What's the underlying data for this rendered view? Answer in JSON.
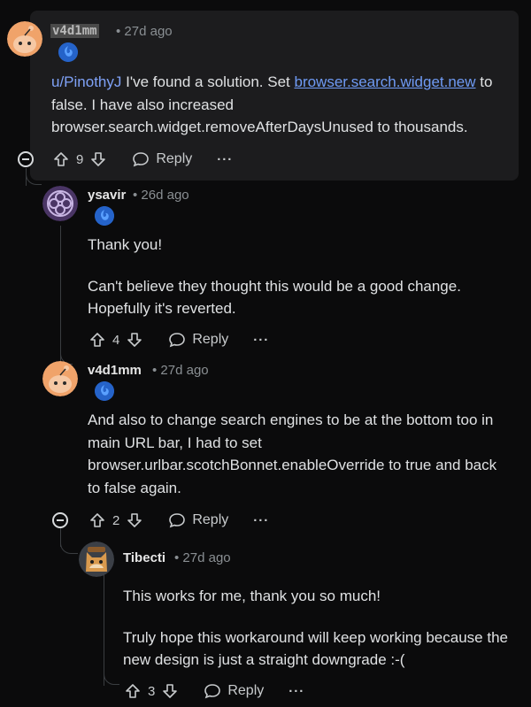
{
  "comments": [
    {
      "username": "v4d1mm",
      "time": "• 27d ago",
      "text_mention": "u/PinothyJ",
      "text_part1": " I've found a solution. Set ",
      "text_link": "browser.search.widget.new",
      "text_part2": " to false. I have also increased browser.search.widget.removeAfterDaysUnused to thousands.",
      "votes": "9",
      "reply_label": "Reply",
      "more_label": "···"
    },
    {
      "username": "ysavir",
      "time": "• 26d ago",
      "paragraphs": [
        "Thank you!",
        "Can't believe they thought this would be a good change. Hopefully it's reverted."
      ],
      "votes": "4",
      "reply_label": "Reply",
      "more_label": "···"
    },
    {
      "username": "v4d1mm",
      "time": "• 27d ago",
      "paragraphs": [
        "And also to change search engines to be at the bottom too in main URL bar, I had to set browser.urlbar.scotchBonnet.enableOverride to true and back to false again."
      ],
      "votes": "2",
      "reply_label": "Reply",
      "more_label": "···"
    },
    {
      "username": "Tibecti",
      "time": "• 27d ago",
      "paragraphs": [
        "This works for me, thank you so much!",
        "Truly hope this workaround will keep working because the new design is just a straight downgrade :-("
      ],
      "votes": "3",
      "reply_label": "Reply",
      "more_label": "···"
    }
  ],
  "colors": {
    "background": "#0b0b0c",
    "highlight": "#1c1c1e",
    "link": "#6f9bf5",
    "flair": "#2563c9",
    "snoo_orange": "#f0a36a"
  },
  "icons": [
    "snoo-avatar-icon",
    "firefox-flair-icon",
    "upvote-icon",
    "downvote-icon",
    "comment-icon",
    "collapse-icon",
    "celtic-knot-avatar-icon",
    "cat-avatar-icon"
  ]
}
